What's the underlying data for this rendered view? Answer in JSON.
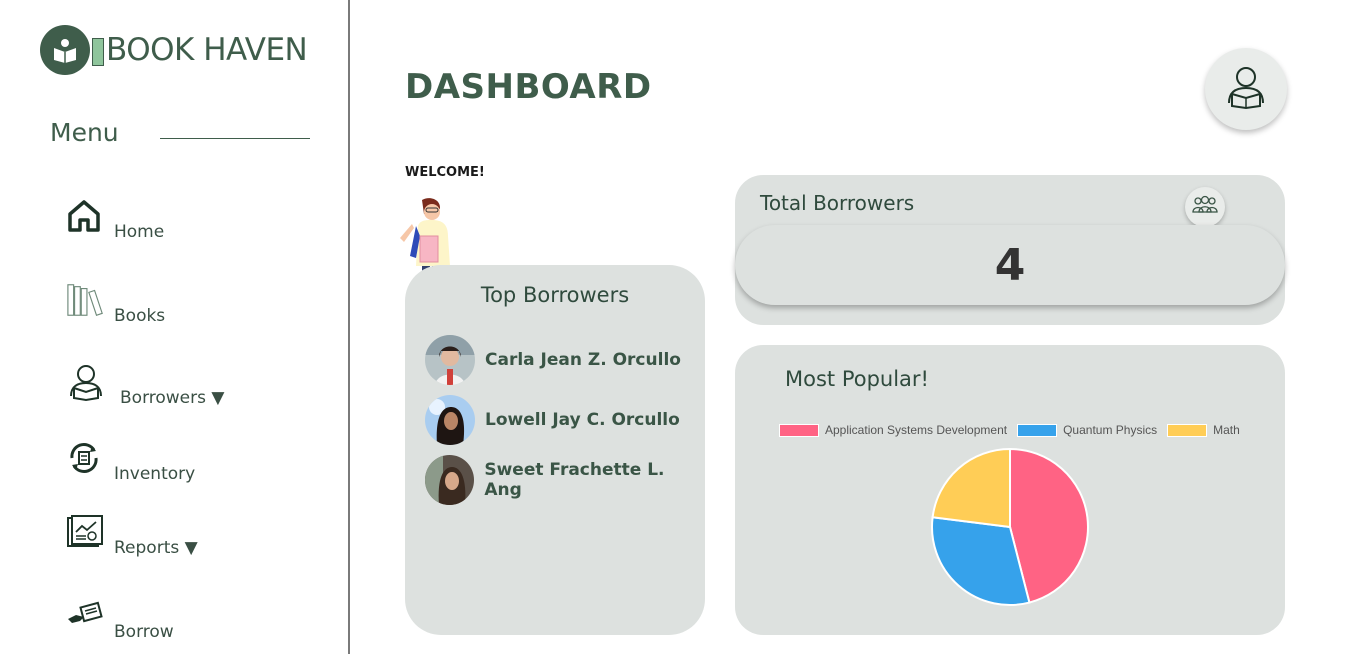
{
  "app": {
    "name": "BOOK HAVEN"
  },
  "sidebar": {
    "menu_title": "Menu",
    "items": [
      {
        "label": "Home",
        "icon": "home-icon"
      },
      {
        "label": "Books",
        "icon": "books-icon"
      },
      {
        "label": "Borrowers ▼",
        "icon": "reader-icon"
      },
      {
        "label": "Inventory",
        "icon": "inventory-icon"
      },
      {
        "label": "Reports ▼",
        "icon": "reports-icon"
      },
      {
        "label": "Borrow",
        "icon": "borrow-hand-icon"
      }
    ]
  },
  "header": {
    "title": "DASHBOARD",
    "profile_icon": "user-reading-icon"
  },
  "welcome": "WELCOME!",
  "top_borrowers": {
    "title": "Top Borrowers",
    "list": [
      {
        "name": "Carla Jean Z. Orcullo"
      },
      {
        "name": "Lowell Jay C. Orcullo"
      },
      {
        "name": "Sweet Frachette L. Ang"
      }
    ]
  },
  "total_borrowers": {
    "title": "Total Borrowers",
    "value": "4",
    "icon": "group-icon"
  },
  "most_popular": {
    "title": "Most Popular!"
  },
  "colors": {
    "primary": "#3f5d4b",
    "card": "#dde1df",
    "pink": "#ff6384",
    "blue": "#36a2eb",
    "yellow": "#ffcd56"
  },
  "chart_data": {
    "type": "pie",
    "categories": [
      "Application Systems Development",
      "Quantum Physics",
      "Math"
    ],
    "values": [
      46,
      31,
      23
    ],
    "colors": [
      "#ff6384",
      "#36a2eb",
      "#ffcd56"
    ],
    "legend": "top"
  }
}
